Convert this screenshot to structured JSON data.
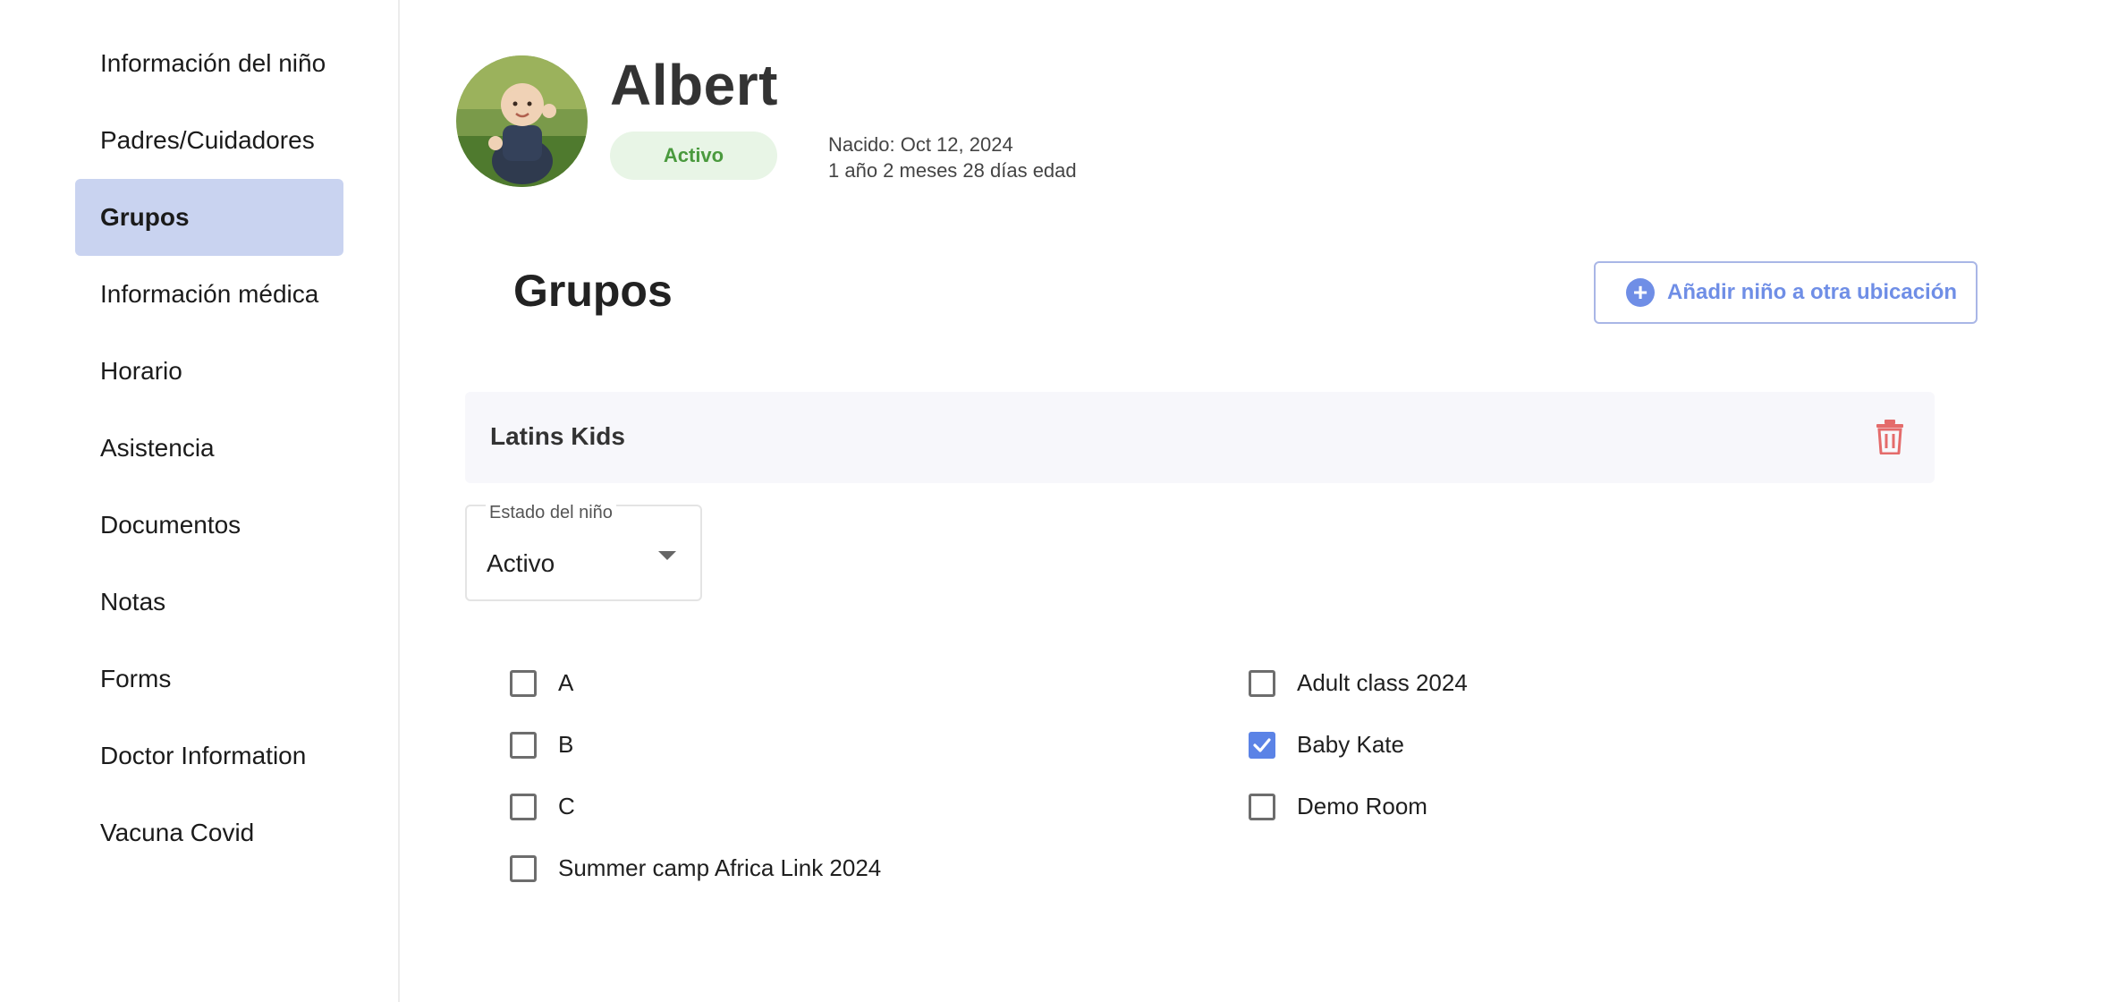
{
  "sidebar": {
    "items": [
      {
        "label": "Información del niño",
        "active": false
      },
      {
        "label": "Padres/Cuidadores",
        "active": false
      },
      {
        "label": "Grupos",
        "active": true
      },
      {
        "label": "Información médica",
        "active": false
      },
      {
        "label": "Horario",
        "active": false
      },
      {
        "label": "Asistencia",
        "active": false
      },
      {
        "label": "Documentos",
        "active": false
      },
      {
        "label": "Notas",
        "active": false
      },
      {
        "label": "Forms",
        "active": false
      },
      {
        "label": "Doctor Information",
        "active": false
      },
      {
        "label": "Vacuna Covid",
        "active": false
      }
    ]
  },
  "profile": {
    "name": "Albert",
    "status": "Activo",
    "born": "Nacido: Oct 12, 2024",
    "age": "1 año 2 meses 28 días edad"
  },
  "section": {
    "title": "Grupos",
    "add_label": "Añadir niño a otra ubicación"
  },
  "group": {
    "name": "Latins Kids",
    "status_label": "Estado del niño",
    "status_value": "Activo",
    "rooms": [
      {
        "label": "A",
        "checked": false
      },
      {
        "label": "Adult class 2024",
        "checked": false
      },
      {
        "label": "B",
        "checked": false
      },
      {
        "label": "Baby Kate",
        "checked": true
      },
      {
        "label": "C",
        "checked": false
      },
      {
        "label": "Demo Room",
        "checked": false
      },
      {
        "label": "Summer camp Africa Link 2024",
        "checked": false
      }
    ]
  },
  "colors": {
    "accent": "#6f8ee6",
    "active_nav": "#c9d3f0",
    "status_green": "#4a9a3e",
    "delete_red": "#e46b6b",
    "checkbox_checked": "#5b83e6"
  }
}
